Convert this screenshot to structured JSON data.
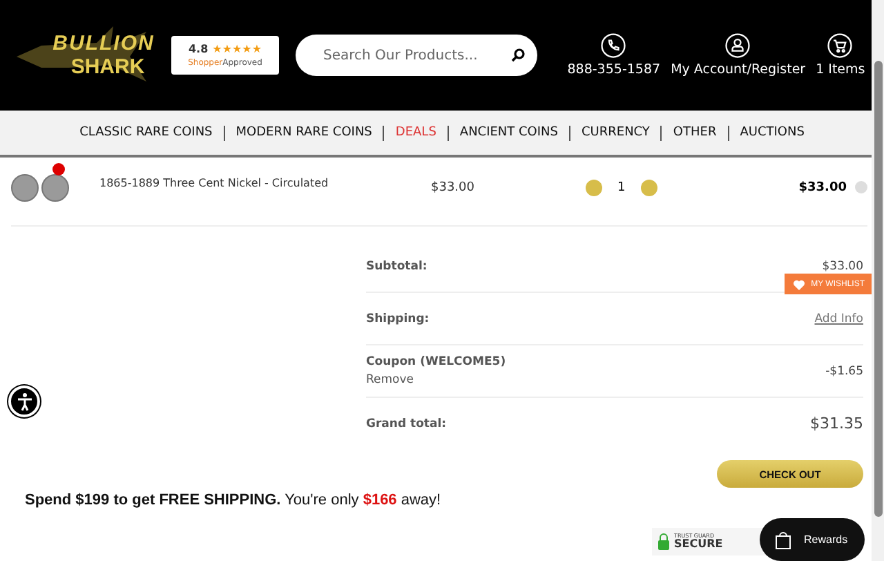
{
  "logo": {
    "word_top": "BULLION",
    "word_bottom": "SHARK"
  },
  "rating": {
    "score": "4.8",
    "stars": 5,
    "brand_left": "Shopper",
    "brand_right": "Approved"
  },
  "search": {
    "placeholder": "Search Our Products..."
  },
  "header_links": [
    {
      "kind": "phone",
      "label": "888-355-1587"
    },
    {
      "kind": "account",
      "label": "My Account/Register"
    },
    {
      "kind": "cart",
      "label": "1 Items"
    }
  ],
  "nav": [
    {
      "label": "CLASSIC RARE COINS",
      "highlight": false
    },
    {
      "label": "MODERN RARE COINS",
      "highlight": false
    },
    {
      "label": "DEALS",
      "highlight": true
    },
    {
      "label": "ANCIENT COINS",
      "highlight": false
    },
    {
      "label": "CURRENCY",
      "highlight": false
    },
    {
      "label": "OTHER",
      "highlight": false
    },
    {
      "label": "AUCTIONS",
      "highlight": false
    }
  ],
  "cart_item": {
    "name": "1865-1889 Three Cent Nickel - Circulated",
    "price": "$33.00",
    "quantity": "1",
    "total": "$33.00"
  },
  "summary": [
    {
      "kind": "plain",
      "label": "Subtotal:",
      "value": "$33.00"
    },
    {
      "kind": "link",
      "label": "Shipping:",
      "value": "Add Info"
    },
    {
      "kind": "coupon",
      "label": "Coupon (WELCOME5)",
      "sub": "Remove",
      "value": "-$1.65"
    },
    {
      "kind": "total",
      "label": "Grand total:",
      "value": "$31.35"
    }
  ],
  "wishlist": {
    "label": "MY WISHLIST"
  },
  "checkout": {
    "label": "CHECK OUT"
  },
  "shipping_note": {
    "lead": "Spend $199 to get FREE SHIPPING.",
    "middle": "You're only",
    "amount": "$166",
    "tail": "away!"
  },
  "trust_badge": {
    "top": "TRUST GUARD",
    "main": "SECURE"
  },
  "rewards": {
    "label": "Rewards"
  }
}
